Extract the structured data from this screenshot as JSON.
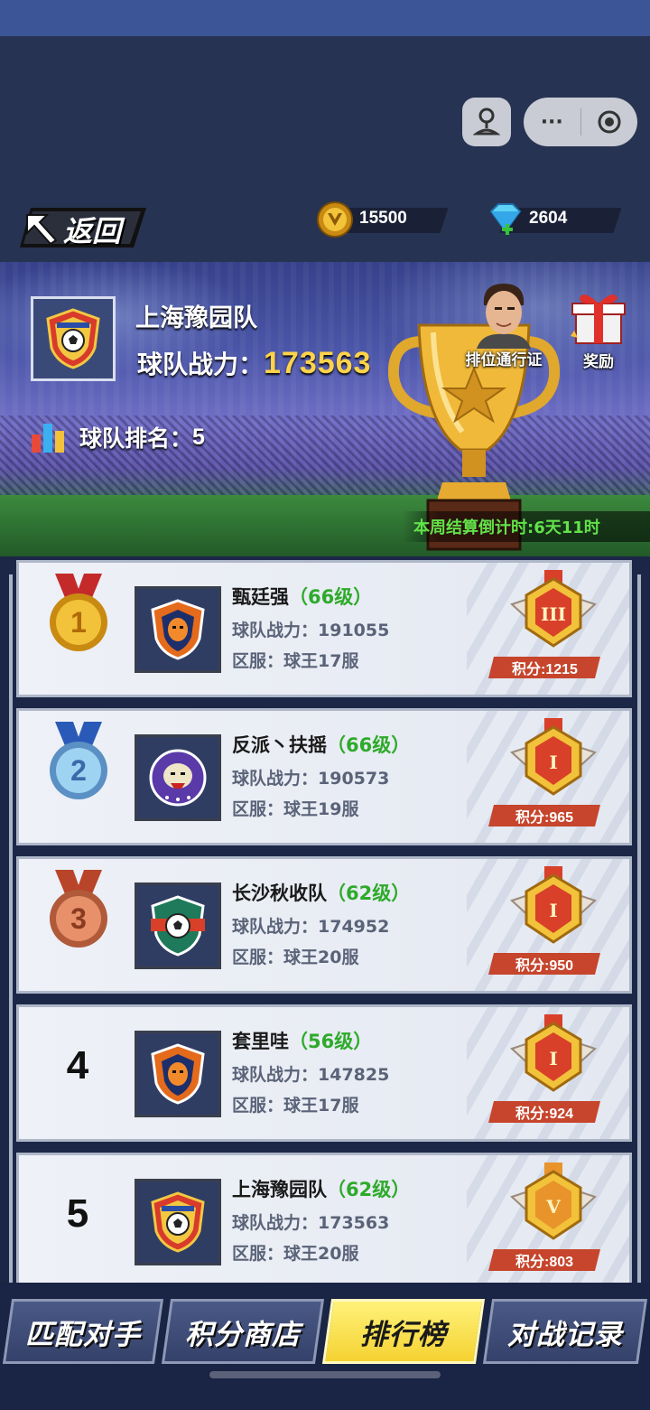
{
  "header": {
    "back_label": "返回",
    "currencies": [
      {
        "name": "gold-coin",
        "value": "15500"
      },
      {
        "name": "diamond",
        "value": "2604"
      }
    ],
    "capsule": {
      "more": "···"
    }
  },
  "banner": {
    "team_name": "上海豫园队",
    "power_label": "球队战力：",
    "power_value": "173563",
    "rank_label": "球队排名：",
    "rank_value": "5",
    "pass_label": "排位通行证",
    "reward_label": "奖励",
    "countdown": "本周结算倒计时:6天11时"
  },
  "ranking": [
    {
      "rank": "1",
      "name": "甄廷强",
      "level": "（66级）",
      "power": "球队战力：191055",
      "server": "区服：球王17服",
      "score": "积分:1215",
      "badge": "III",
      "logo": "tiger-crest"
    },
    {
      "rank": "2",
      "name": "反派丶扶摇",
      "level": "（66级）",
      "power": "球队战力：190573",
      "server": "区服：球王19服",
      "score": "积分:965",
      "badge": "I",
      "logo": "bulldog-crest"
    },
    {
      "rank": "3",
      "name": "长沙秋收队",
      "level": "（62级）",
      "power": "球队战力：174952",
      "server": "区服：球王20服",
      "score": "积分:950",
      "badge": "I",
      "logo": "ball-shield-crest"
    },
    {
      "rank": "4",
      "name": "套里哇",
      "level": "（56级）",
      "power": "球队战力：147825",
      "server": "区服：球王17服",
      "score": "积分:924",
      "badge": "I",
      "logo": "tiger-crest"
    },
    {
      "rank": "5",
      "name": "上海豫园队",
      "level": "（62级）",
      "power": "球队战力：173563",
      "server": "区服：球王20服",
      "score": "积分:803",
      "badge": "V",
      "logo": "ball-crest"
    }
  ],
  "tabs": [
    {
      "label": "匹配对手",
      "active": false
    },
    {
      "label": "积分商店",
      "active": false
    },
    {
      "label": "排行榜",
      "active": true
    },
    {
      "label": "对战记录",
      "active": false
    }
  ],
  "colors": {
    "level_green": "#2eaa2a",
    "score_red": "#c6452c",
    "power_gold": "#ffd34a",
    "countdown_green": "#62e24a"
  }
}
